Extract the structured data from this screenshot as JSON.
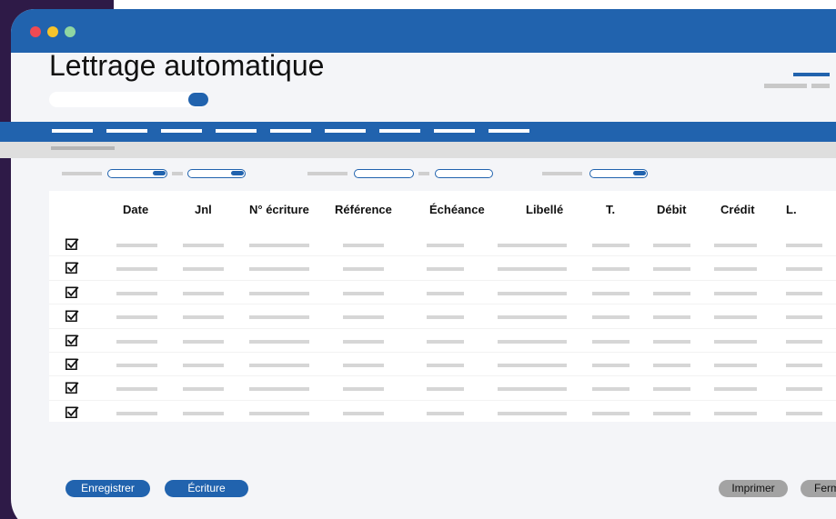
{
  "window": {
    "title": "Lettrage automatique"
  },
  "table": {
    "columns": [
      "Date",
      "Jnl",
      "N° écriture",
      "Référence",
      "Échéance",
      "Libellé",
      "T.",
      "Débit",
      "Crédit",
      "L."
    ],
    "row_count": 8,
    "rows_checked": [
      true,
      true,
      true,
      true,
      true,
      true,
      true,
      true
    ]
  },
  "footer": {
    "left_buttons": [
      "Enregistrer",
      "Écriture"
    ],
    "right_buttons": [
      "Imprimer",
      "Fermer"
    ]
  },
  "colors": {
    "accent": "#2163ae",
    "panel": "#f4f5f8",
    "outer": "#2e1a47"
  },
  "icons": [
    "close-dot",
    "minimize-dot",
    "maximize-dot",
    "checkbox-checked-icon",
    "toggle-icon"
  ]
}
